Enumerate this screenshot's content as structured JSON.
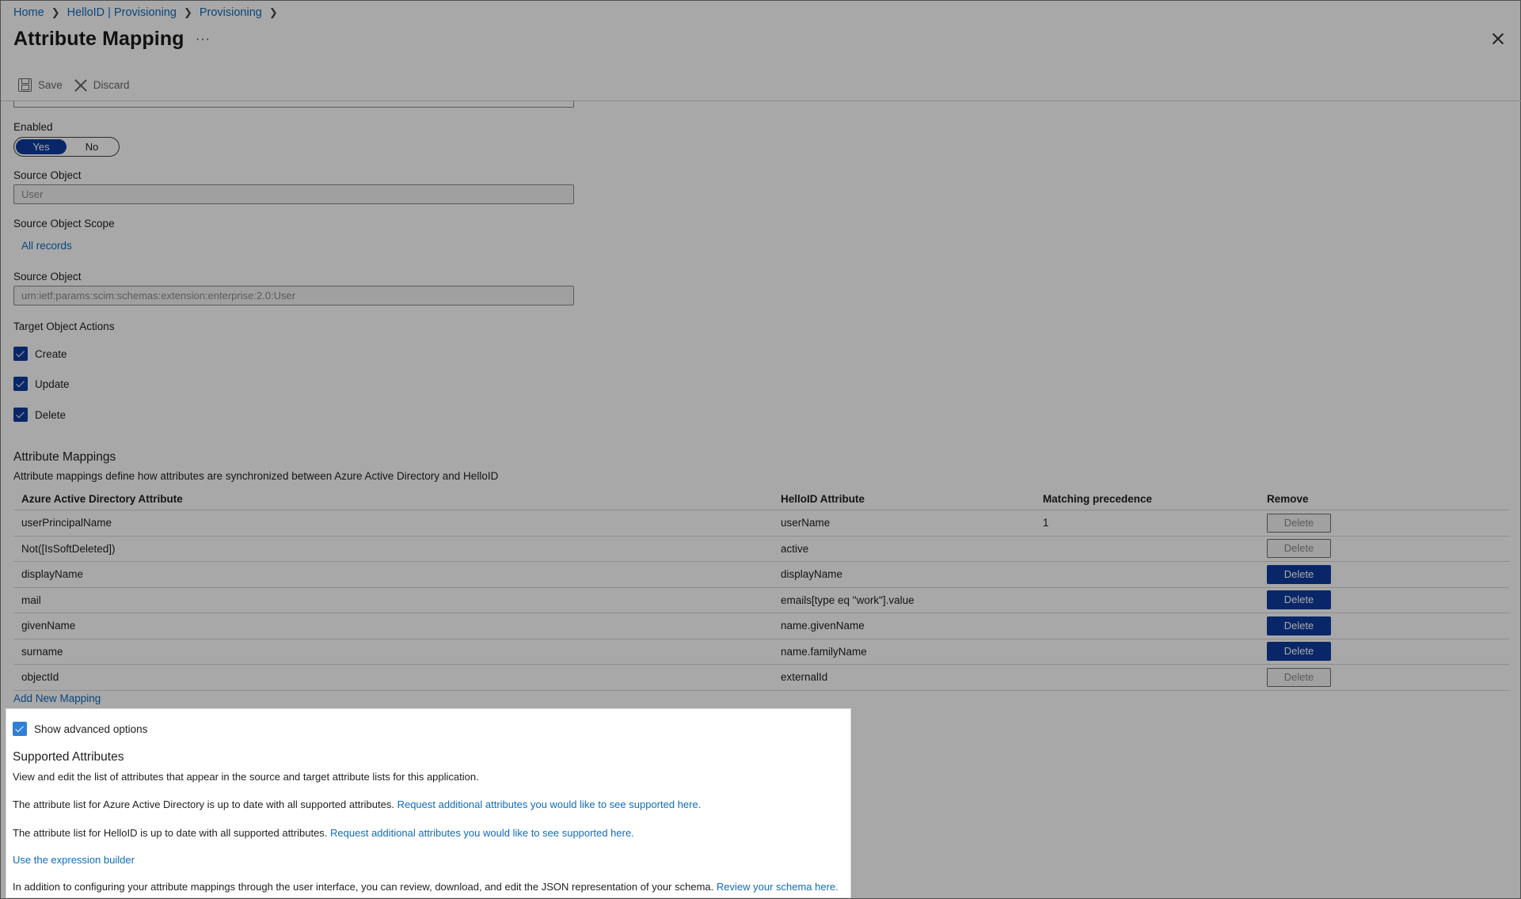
{
  "breadcrumb": [
    {
      "label": "Home"
    },
    {
      "label": "HelloID | Provisioning"
    },
    {
      "label": "Provisioning"
    }
  ],
  "page": {
    "title": "Attribute Mapping",
    "more_glyph": "···"
  },
  "toolbar": {
    "save_label": "Save",
    "discard_label": "Discard"
  },
  "form": {
    "enabled_label": "Enabled",
    "toggle_yes": "Yes",
    "toggle_no": "No",
    "toggle_selected": "Yes",
    "source_object_label": "Source Object",
    "source_object_value": "User",
    "source_scope_label": "Source Object Scope",
    "source_scope_link": "All records",
    "source_object2_label": "Source Object",
    "source_object2_value": "urn:ietf:params:scim:schemas:extension:enterprise:2.0:User",
    "target_actions_label": "Target Object Actions",
    "actions": [
      {
        "label": "Create",
        "checked": true
      },
      {
        "label": "Update",
        "checked": true
      },
      {
        "label": "Delete",
        "checked": true
      }
    ]
  },
  "mappings": {
    "title": "Attribute Mappings",
    "description": "Attribute mappings define how attributes are synchronized between Azure Active Directory and HelloID",
    "columns": [
      "Azure Active Directory Attribute",
      "HelloID Attribute",
      "Matching precedence",
      "Remove"
    ],
    "rows": [
      {
        "source": "userPrincipalName",
        "target": "userName",
        "precedence": "1",
        "delete": "Delete",
        "delete_enabled": false
      },
      {
        "source": "Not([IsSoftDeleted])",
        "target": "active",
        "precedence": "",
        "delete": "Delete",
        "delete_enabled": false
      },
      {
        "source": "displayName",
        "target": "displayName",
        "precedence": "",
        "delete": "Delete",
        "delete_enabled": true
      },
      {
        "source": "mail",
        "target": "emails[type eq \"work\"].value",
        "precedence": "",
        "delete": "Delete",
        "delete_enabled": true
      },
      {
        "source": "givenName",
        "target": "name.givenName",
        "precedence": "",
        "delete": "Delete",
        "delete_enabled": true
      },
      {
        "source": "surname",
        "target": "name.familyName",
        "precedence": "",
        "delete": "Delete",
        "delete_enabled": true
      },
      {
        "source": "objectId",
        "target": "externalId",
        "precedence": "",
        "delete": "Delete",
        "delete_enabled": false
      }
    ],
    "add_link": "Add New Mapping"
  },
  "advanced": {
    "show_label": "Show advanced options",
    "checked": true,
    "title": "Supported Attributes",
    "intro": "View and edit the list of attributes that appear in the source and target attribute lists for this application.",
    "aad_text": "The attribute list for Azure Active Directory is up to date with all supported attributes.",
    "aad_link": "Request additional attributes you would like to see supported here.",
    "helloid_text": "The attribute list for HelloID is up to date with all supported attributes.",
    "helloid_link": "Request additional attributes you would like to see supported here.",
    "expression_link": "Use the expression builder",
    "json_text": "In addition to configuring your attribute mappings through the user interface, you can review, download, and edit the JSON representation of your schema.",
    "json_link": "Review your schema here."
  },
  "colors": {
    "primary": "#0f3c9e",
    "link": "#0f6cbd"
  }
}
